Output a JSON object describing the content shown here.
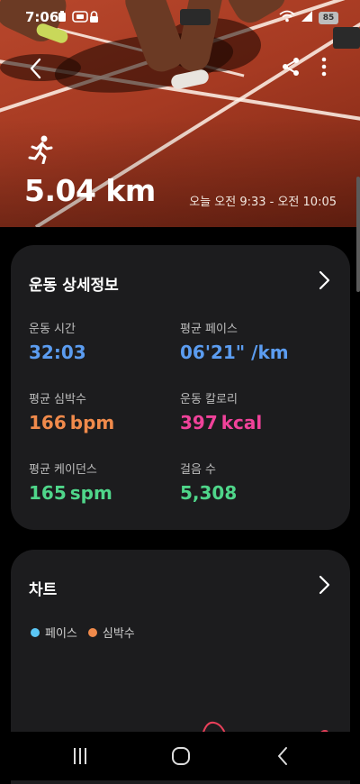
{
  "status_bar": {
    "time": "7:06",
    "battery": "85",
    "left_icons": [
      "battery-saver-icon",
      "cast-icon",
      "lock-icon"
    ],
    "right_icons": [
      "wifi-icon",
      "signal-icon"
    ]
  },
  "hero": {
    "activity_icon": "running-icon",
    "distance": "5.04 km",
    "time_range": "오늘 오전 9:33 - 오전 10:05"
  },
  "details": {
    "title": "운동 상세정보",
    "metrics": [
      {
        "label": "운동 시간",
        "value": "32:03",
        "unit": "",
        "color": "#5b9cf0"
      },
      {
        "label": "평균 페이스",
        "value": "06'21\" /km",
        "unit": "",
        "color": "#5b9cf0"
      },
      {
        "label": "평균 심박수",
        "value": "166",
        "unit": "bpm",
        "color": "#f08a4b"
      },
      {
        "label": "운동 칼로리",
        "value": "397",
        "unit": "kcal",
        "color": "#f0429a"
      },
      {
        "label": "평균 케이던스",
        "value": "165",
        "unit": "spm",
        "color": "#4fd68a"
      },
      {
        "label": "걸음 수",
        "value": "5,308",
        "unit": "",
        "color": "#4fd68a"
      }
    ]
  },
  "chart": {
    "title": "차트",
    "legend": [
      {
        "label": "페이스",
        "color": "#5bc6f5"
      },
      {
        "label": "심박수",
        "color": "#f08a4b"
      }
    ],
    "heart_line_color": "#e8405a"
  },
  "colors": {
    "background": "#000000",
    "card": "#1c1c1e",
    "label": "#bdbdbd"
  }
}
